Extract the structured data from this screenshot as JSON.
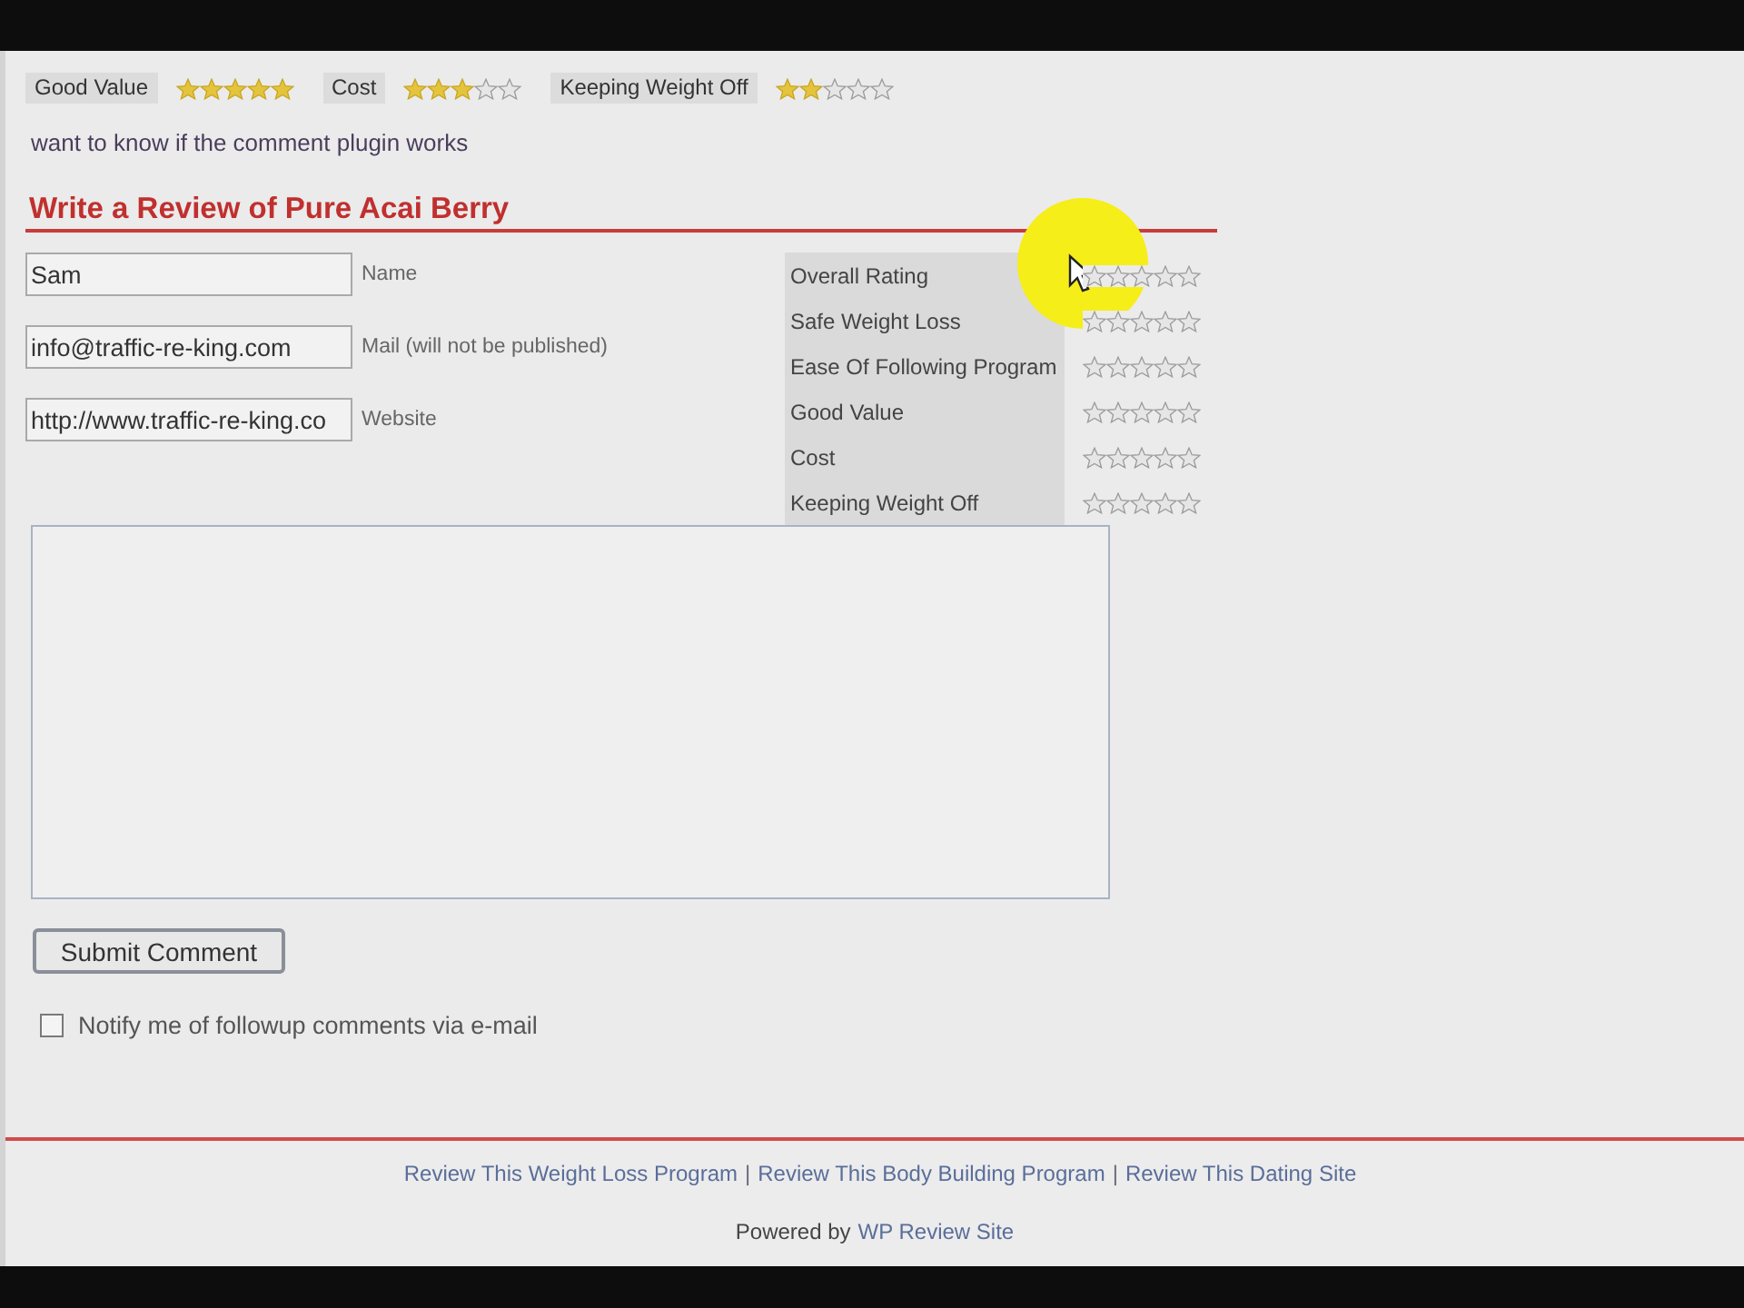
{
  "ratings_summary": [
    {
      "label": "Good Value",
      "stars": 5
    },
    {
      "label": "Cost",
      "stars": 3
    },
    {
      "label": "Keeping Weight Off",
      "stars": 2
    }
  ],
  "comment": "want to know if the comment plugin works",
  "review_form": {
    "heading": "Write a Review of Pure Acai Berry",
    "fields": [
      {
        "label": "Name",
        "value": "Sam"
      },
      {
        "label": "Mail (will not be published)",
        "value": "info@traffic-re-king.com"
      },
      {
        "label": "Website",
        "value": "http://www.traffic-re-king.co"
      }
    ],
    "ratings": [
      {
        "label": "Overall Rating",
        "stars": 0
      },
      {
        "label": "Safe Weight Loss",
        "stars": 0
      },
      {
        "label": "Ease Of Following Program",
        "stars": 0
      },
      {
        "label": "Good Value",
        "stars": 0
      },
      {
        "label": "Cost",
        "stars": 0
      },
      {
        "label": "Keeping Weight Off",
        "stars": 0
      }
    ],
    "submit": "Submit Comment",
    "notify": {
      "label": "Notify me of followup comments via e-mail",
      "checked": false
    }
  },
  "footer": {
    "links": [
      "Review This Weight Loss Program",
      "Review This Body Building Program",
      "Review This Dating Site"
    ],
    "separator": "|",
    "powered_by": "Powered by",
    "powered_link": "WP Review Site"
  }
}
